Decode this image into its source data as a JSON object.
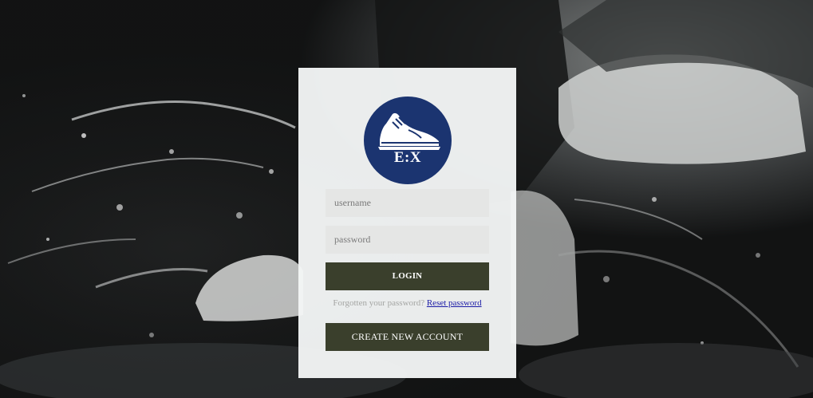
{
  "logo": {
    "text": "E:X",
    "icon": "sneaker-icon",
    "background": "#1b3470"
  },
  "form": {
    "username_placeholder": "username",
    "username_value": "",
    "password_placeholder": "password",
    "password_value": "",
    "login_label": "LOGIN",
    "forgot_text": "Forgotten your password?",
    "reset_link": "Reset password",
    "create_label": "CREATE NEW ACCOUNT"
  },
  "colors": {
    "button": "#3a3f2c",
    "link": "#1a1aa6",
    "card": "#f4f6f6"
  }
}
